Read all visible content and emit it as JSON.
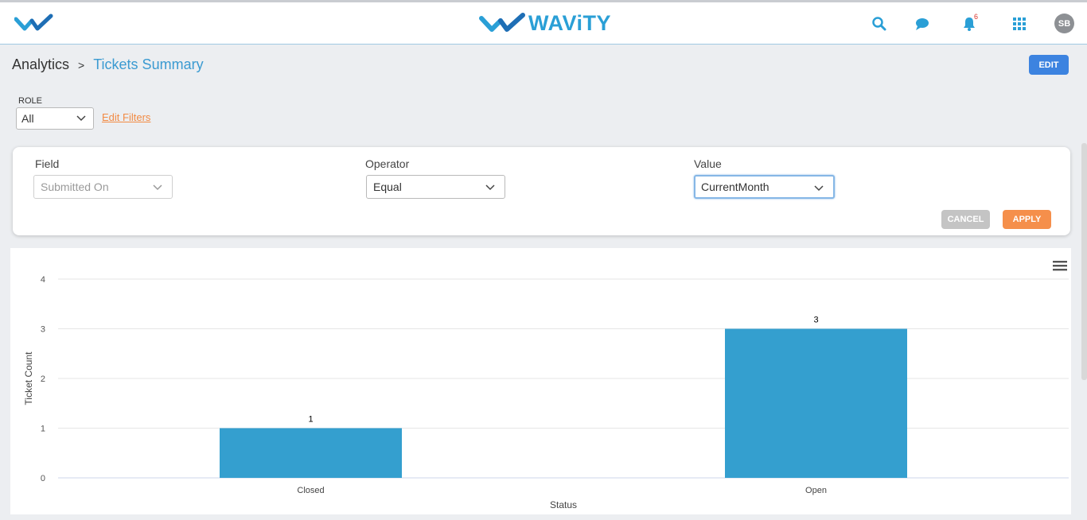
{
  "header": {
    "brand": "WAViTY",
    "notification_count": "6",
    "avatar_initials": "SB",
    "icons": [
      "wavity-logo-icon",
      "search-icon",
      "chat-icon",
      "bell-icon",
      "apps-grid-icon"
    ],
    "accent_color": "#2a9fd6"
  },
  "breadcrumb": {
    "root": "Analytics",
    "separator": ">",
    "current": "Tickets Summary"
  },
  "toolbar": {
    "edit_label": "EDIT"
  },
  "role_filter": {
    "label": "ROLE",
    "value": "All",
    "edit_filters_label": "Edit Filters"
  },
  "filter_panel": {
    "field": {
      "label": "Field",
      "value": "Submitted On"
    },
    "operator": {
      "label": "Operator",
      "value": "Equal"
    },
    "value": {
      "label": "Value",
      "value": "CurrentMonth"
    },
    "cancel_label": "CANCEL",
    "apply_label": "APPLY"
  },
  "chart_data": {
    "type": "bar",
    "categories": [
      "Closed",
      "Open"
    ],
    "values": [
      1,
      3
    ],
    "xlabel": "Status",
    "ylabel": "Ticket Count",
    "ylim": [
      0,
      4
    ],
    "yticks": [
      0,
      1,
      2,
      3,
      4
    ],
    "grid": true,
    "bar_color": "#349fcf",
    "data_labels": true
  }
}
